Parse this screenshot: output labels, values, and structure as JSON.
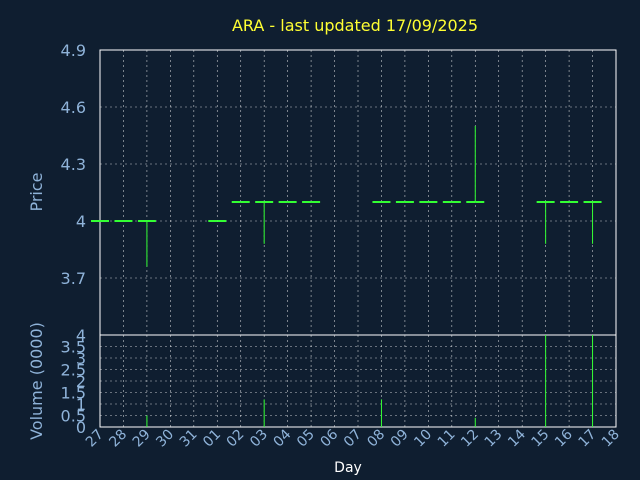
{
  "chart_data": [
    {
      "type": "ohlc",
      "title": "ARA - last updated 17/09/2025",
      "xlabel": "",
      "ylabel": "Price",
      "ylim": [
        3.4,
        4.9
      ],
      "yticks": [
        "3.7",
        "4",
        "4.3",
        "4.6",
        "4.9"
      ],
      "ytick_values": [
        3.7,
        4.0,
        4.3,
        4.6,
        4.9
      ],
      "grid": true,
      "color": "#33ff33",
      "x": [
        "27",
        "28",
        "29",
        "30",
        "31",
        "01",
        "02",
        "03",
        "04",
        "05",
        "06",
        "07",
        "08",
        "09",
        "10",
        "11",
        "12",
        "13",
        "14",
        "15",
        "16",
        "17",
        "18"
      ],
      "series": [
        {
          "day": "27",
          "open": 4.0,
          "high": 4.0,
          "low": 4.0,
          "close": 4.0
        },
        {
          "day": "28",
          "open": 4.0,
          "high": 4.0,
          "low": 4.0,
          "close": 4.0
        },
        {
          "day": "29",
          "open": 4.0,
          "high": 4.0,
          "low": 3.76,
          "close": 4.0
        },
        {
          "day": "01",
          "open": 4.0,
          "high": 4.0,
          "low": 4.0,
          "close": 4.0
        },
        {
          "day": "02",
          "open": 4.1,
          "high": 4.1,
          "low": 4.1,
          "close": 4.1
        },
        {
          "day": "03",
          "open": 4.1,
          "high": 4.1,
          "low": 3.88,
          "close": 4.1
        },
        {
          "day": "04",
          "open": 4.1,
          "high": 4.1,
          "low": 4.1,
          "close": 4.1
        },
        {
          "day": "05",
          "open": 4.1,
          "high": 4.1,
          "low": 4.1,
          "close": 4.1
        },
        {
          "day": "08",
          "open": 4.1,
          "high": 4.1,
          "low": 4.1,
          "close": 4.1
        },
        {
          "day": "09",
          "open": 4.1,
          "high": 4.1,
          "low": 4.1,
          "close": 4.1
        },
        {
          "day": "10",
          "open": 4.1,
          "high": 4.1,
          "low": 4.1,
          "close": 4.1
        },
        {
          "day": "11",
          "open": 4.1,
          "high": 4.1,
          "low": 4.1,
          "close": 4.1
        },
        {
          "day": "12",
          "open": 4.1,
          "high": 4.5,
          "low": 4.1,
          "close": 4.1
        },
        {
          "day": "15",
          "open": 4.1,
          "high": 4.1,
          "low": 3.88,
          "close": 4.1
        },
        {
          "day": "16",
          "open": 4.1,
          "high": 4.1,
          "low": 4.1,
          "close": 4.1
        },
        {
          "day": "17",
          "open": 4.1,
          "high": 4.1,
          "low": 3.88,
          "close": 4.1
        }
      ]
    },
    {
      "type": "bar",
      "xlabel": "Day",
      "ylabel": "Volume (0000)",
      "ylim": [
        0,
        4
      ],
      "yticks": [
        "0",
        "0.5",
        "1",
        "1.5",
        "2",
        "2.5",
        "3",
        "3.5",
        "4"
      ],
      "ytick_values": [
        0,
        0.5,
        1,
        1.5,
        2,
        2.5,
        3,
        3.5,
        4
      ],
      "grid": true,
      "color": "#33ff33",
      "x": [
        "27",
        "28",
        "29",
        "30",
        "31",
        "01",
        "02",
        "03",
        "04",
        "05",
        "06",
        "07",
        "08",
        "09",
        "10",
        "11",
        "12",
        "13",
        "14",
        "15",
        "16",
        "17",
        "18"
      ],
      "bars": [
        {
          "day": "29",
          "value": 0.5
        },
        {
          "day": "03",
          "value": 1.2
        },
        {
          "day": "08",
          "value": 1.2
        },
        {
          "day": "12",
          "value": 0.4
        },
        {
          "day": "15",
          "value": 4.0
        },
        {
          "day": "17",
          "value": 4.0
        }
      ]
    }
  ]
}
